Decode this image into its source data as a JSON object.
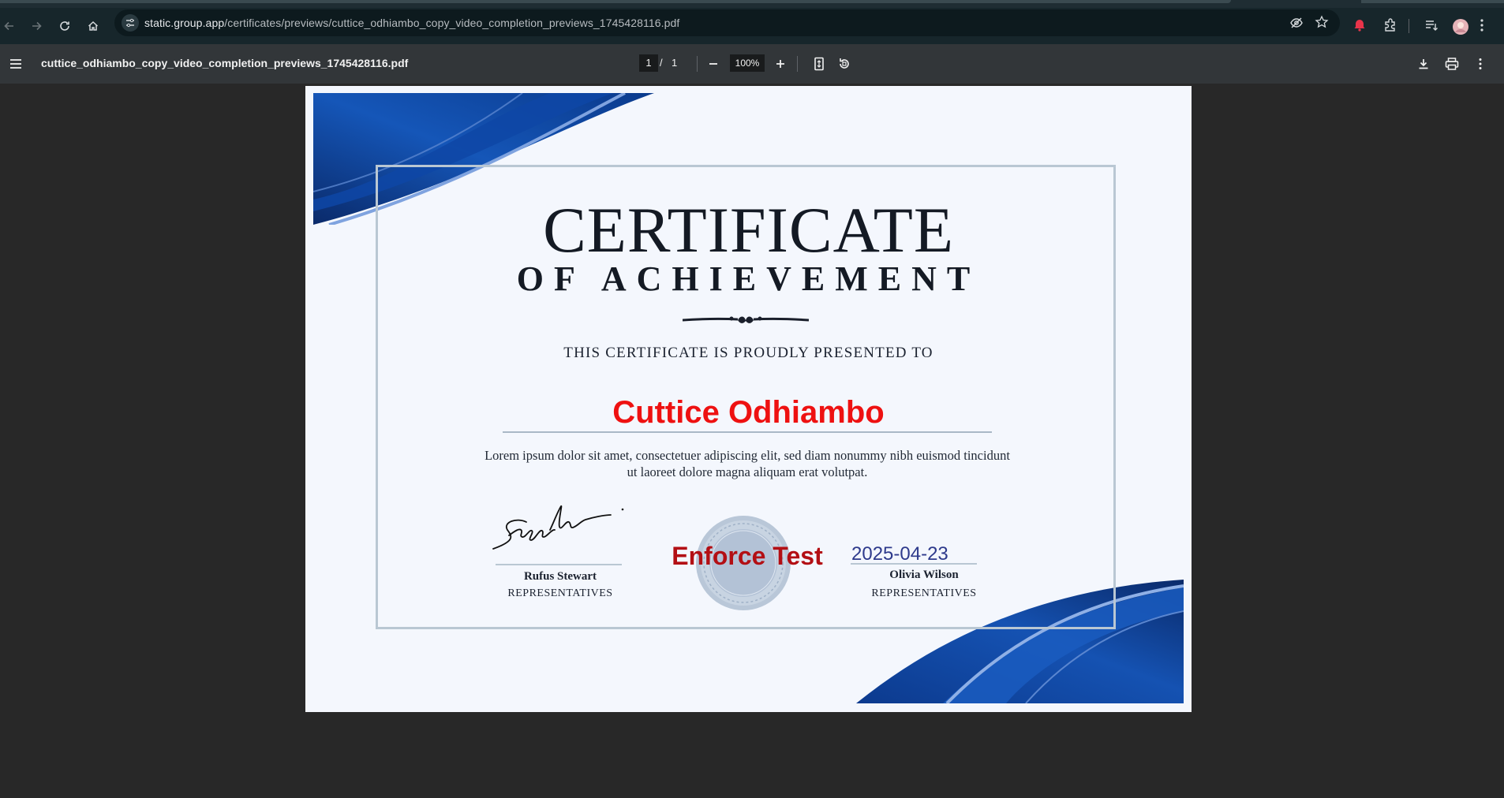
{
  "browser": {
    "url_host": "static.group.app",
    "url_path": "/certificates/previews/cuttice_odhiambo_copy_video_completion_previews_1745428116.pdf"
  },
  "pdf_viewer": {
    "filename": "cuttice_odhiambo_copy_video_completion_previews_1745428116.pdf",
    "current_page": "1",
    "page_separator": "/",
    "total_pages": "1",
    "zoom": "100%"
  },
  "certificate": {
    "title": "CERTIFICATE",
    "subtitle": "OF ACHIEVEMENT",
    "presented_to": "THIS CERTIFICATE IS PROUDLY PRESENTED TO",
    "recipient": "Cuttice Odhiambo",
    "body_line1": "Lorem ipsum dolor sit amet, consectetuer adipiscing elit, sed diam nonummy nibh euismod tincidunt",
    "body_line2": "ut laoreet dolore magna aliquam erat volutpat.",
    "signature_text": "Signature",
    "left_signer_name": "Rufus Stewart",
    "left_signer_role": "REPRESENTATIVES",
    "right_signer_name": "Olivia Wilson",
    "right_signer_role": "REPRESENTATIVES",
    "seal_overlay_text": "Enforce Test",
    "date": "2025-04-23"
  },
  "colors": {
    "recipient": "#ee1111",
    "seal_text": "#b30f14",
    "date": "#2e3a8c",
    "accent_blue": "#0b3f94"
  }
}
